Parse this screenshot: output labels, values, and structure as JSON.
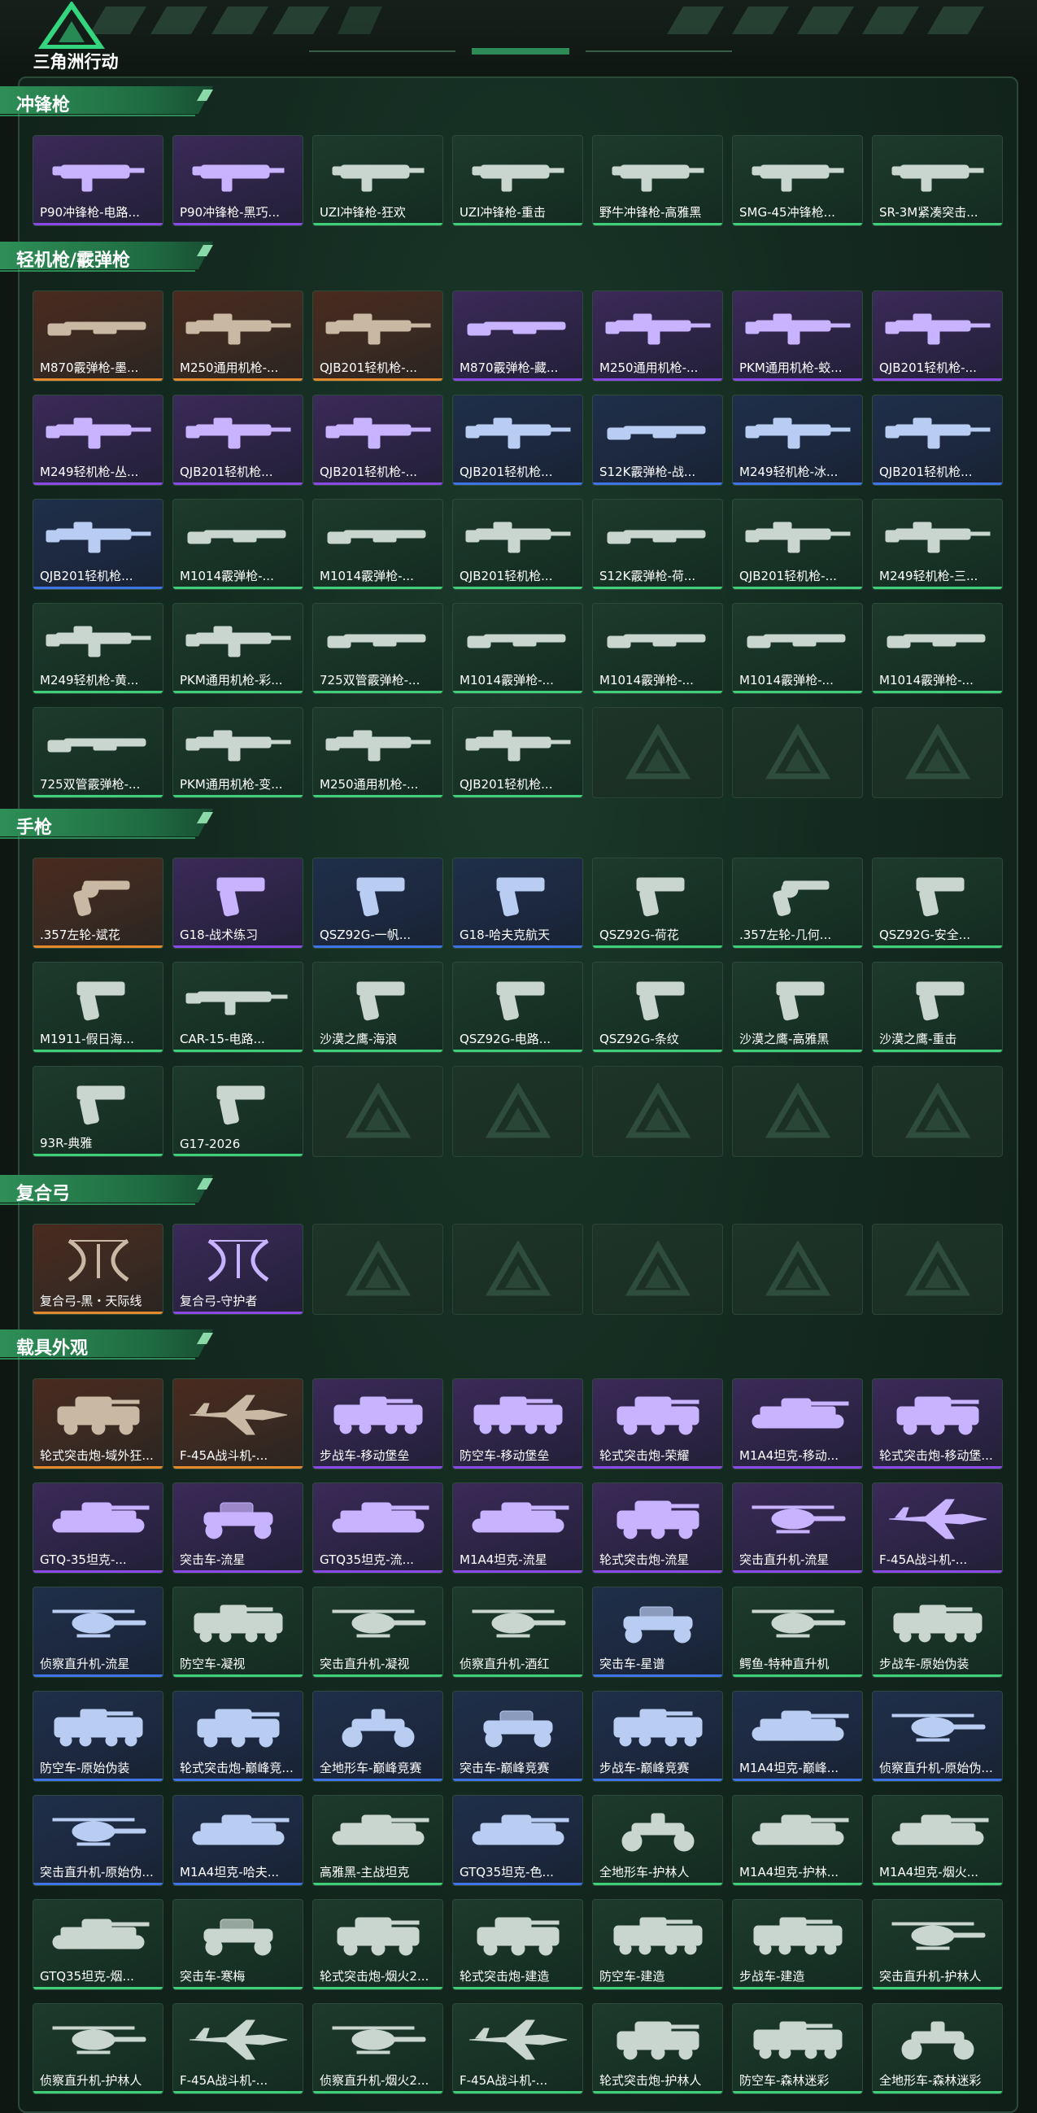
{
  "app": {
    "logo_text": "三角洲行动"
  },
  "colors": {
    "accent": "#3fcf7a",
    "rarity_gold": "#e58a2c",
    "rarity_purple": "#8a4ae6",
    "rarity_blue": "#3f74e6",
    "rarity_green": "#3fcf7a"
  },
  "sections": [
    {
      "title": "冲锋枪",
      "items": [
        {
          "label": "P90冲锋枪-电路...",
          "rarity": "purple",
          "icon": "smg-icon"
        },
        {
          "label": "P90冲锋枪-黑巧...",
          "rarity": "purple",
          "icon": "smg-icon"
        },
        {
          "label": "UZI冲锋枪-狂欢",
          "rarity": "green",
          "icon": "smg-icon"
        },
        {
          "label": "UZI冲锋枪-重击",
          "rarity": "green",
          "icon": "smg-icon"
        },
        {
          "label": "野牛冲锋枪-高雅黑",
          "rarity": "green",
          "icon": "smg-icon"
        },
        {
          "label": "SMG-45冲锋枪...",
          "rarity": "green",
          "icon": "smg-icon"
        },
        {
          "label": "SR-3M紧凑突击...",
          "rarity": "green",
          "icon": "smg-icon"
        }
      ]
    },
    {
      "title": "轻机枪/霰弹枪",
      "items": [
        {
          "label": "M870霰弹枪-墨...",
          "rarity": "gold",
          "icon": "shotgun-icon"
        },
        {
          "label": "M250通用机枪-...",
          "rarity": "gold",
          "icon": "lmg-icon"
        },
        {
          "label": "QJB201轻机枪-...",
          "rarity": "gold",
          "icon": "lmg-icon"
        },
        {
          "label": "M870霰弹枪-藏...",
          "rarity": "purple",
          "icon": "shotgun-icon"
        },
        {
          "label": "M250通用机枪-...",
          "rarity": "purple",
          "icon": "lmg-icon"
        },
        {
          "label": "PKM通用机枪-蛟...",
          "rarity": "purple",
          "icon": "lmg-icon"
        },
        {
          "label": "QJB201轻机枪-...",
          "rarity": "purple",
          "icon": "lmg-icon"
        },
        {
          "label": "M249轻机枪-丛...",
          "rarity": "purple",
          "icon": "lmg-icon"
        },
        {
          "label": "QJB201轻机枪...",
          "rarity": "purple",
          "icon": "lmg-icon"
        },
        {
          "label": "QJB201轻机枪-...",
          "rarity": "purple",
          "icon": "lmg-icon"
        },
        {
          "label": "QJB201轻机枪...",
          "rarity": "blue",
          "icon": "lmg-icon"
        },
        {
          "label": "S12K霰弹枪-战...",
          "rarity": "blue",
          "icon": "shotgun-icon"
        },
        {
          "label": "M249轻机枪-冰...",
          "rarity": "blue",
          "icon": "lmg-icon"
        },
        {
          "label": "QJB201轻机枪...",
          "rarity": "blue",
          "icon": "lmg-icon"
        },
        {
          "label": "QJB201轻机枪...",
          "rarity": "blue",
          "icon": "lmg-icon"
        },
        {
          "label": "M1014霰弹枪-...",
          "rarity": "green",
          "icon": "shotgun-icon"
        },
        {
          "label": "M1014霰弹枪-...",
          "rarity": "green",
          "icon": "shotgun-icon"
        },
        {
          "label": "QJB201轻机枪...",
          "rarity": "green",
          "icon": "lmg-icon"
        },
        {
          "label": "S12K霰弹枪-荷...",
          "rarity": "green",
          "icon": "shotgun-icon"
        },
        {
          "label": "QJB201轻机枪-...",
          "rarity": "green",
          "icon": "lmg-icon"
        },
        {
          "label": "M249轻机枪-三...",
          "rarity": "green",
          "icon": "lmg-icon"
        },
        {
          "label": "M249轻机枪-黄...",
          "rarity": "green",
          "icon": "lmg-icon"
        },
        {
          "label": "PKM通用机枪-彩...",
          "rarity": "green",
          "icon": "lmg-icon"
        },
        {
          "label": "725双管霰弹枪-...",
          "rarity": "green",
          "icon": "shotgun-icon"
        },
        {
          "label": "M1014霰弹枪-...",
          "rarity": "green",
          "icon": "shotgun-icon"
        },
        {
          "label": "M1014霰弹枪-...",
          "rarity": "green",
          "icon": "shotgun-icon"
        },
        {
          "label": "M1014霰弹枪-...",
          "rarity": "green",
          "icon": "shotgun-icon"
        },
        {
          "label": "M1014霰弹枪-...",
          "rarity": "green",
          "icon": "shotgun-icon"
        },
        {
          "label": "725双管霰弹枪-...",
          "rarity": "green",
          "icon": "shotgun-icon"
        },
        {
          "label": "PKM通用机枪-变...",
          "rarity": "green",
          "icon": "lmg-icon"
        },
        {
          "label": "M250通用机枪-...",
          "rarity": "green",
          "icon": "lmg-icon"
        },
        {
          "label": "QJB201轻机枪...",
          "rarity": "green",
          "icon": "lmg-icon"
        },
        {
          "empty": true
        },
        {
          "empty": true
        },
        {
          "empty": true
        }
      ]
    },
    {
      "title": "手枪",
      "items": [
        {
          "label": ".357左轮-斌花",
          "rarity": "gold",
          "icon": "revolver-icon"
        },
        {
          "label": "G18-战术练习",
          "rarity": "purple",
          "icon": "pistol-icon"
        },
        {
          "label": "QSZ92G-一帆...",
          "rarity": "blue",
          "icon": "pistol-icon"
        },
        {
          "label": "G18-哈夫克航天",
          "rarity": "blue",
          "icon": "pistol-icon"
        },
        {
          "label": "QSZ92G-荷花",
          "rarity": "green",
          "icon": "pistol-icon"
        },
        {
          "label": ".357左轮-几何...",
          "rarity": "green",
          "icon": "revolver-icon"
        },
        {
          "label": "QSZ92G-安全...",
          "rarity": "green",
          "icon": "pistol-icon"
        },
        {
          "label": "M1911-假日海...",
          "rarity": "green",
          "icon": "pistol-icon"
        },
        {
          "label": "CAR-15-电路...",
          "rarity": "green",
          "icon": "rifle-icon"
        },
        {
          "label": "沙漠之鹰-海浪",
          "rarity": "green",
          "icon": "pistol-icon"
        },
        {
          "label": "QSZ92G-电路...",
          "rarity": "green",
          "icon": "pistol-icon"
        },
        {
          "label": "QSZ92G-条纹",
          "rarity": "green",
          "icon": "pistol-icon"
        },
        {
          "label": "沙漠之鹰-高雅黑",
          "rarity": "green",
          "icon": "pistol-icon"
        },
        {
          "label": "沙漠之鹰-重击",
          "rarity": "green",
          "icon": "pistol-icon"
        },
        {
          "label": "93R-典雅",
          "rarity": "green",
          "icon": "pistol-icon"
        },
        {
          "label": "G17-2026",
          "rarity": "green",
          "icon": "pistol-icon"
        },
        {
          "empty": true
        },
        {
          "empty": true
        },
        {
          "empty": true
        },
        {
          "empty": true
        },
        {
          "empty": true
        }
      ]
    },
    {
      "title": "复合弓",
      "items": [
        {
          "label": "复合弓-黑・天际线",
          "rarity": "gold",
          "icon": "bow-icon"
        },
        {
          "label": "复合弓-守护者",
          "rarity": "purple",
          "icon": "bow-icon"
        },
        {
          "empty": true
        },
        {
          "empty": true
        },
        {
          "empty": true
        },
        {
          "empty": true
        },
        {
          "empty": true
        }
      ]
    },
    {
      "title": "载具外观",
      "items": [
        {
          "label": "轮式突击炮-域外狂...",
          "rarity": "gold",
          "icon": "armored-car-icon"
        },
        {
          "label": "F-45A战斗机-...",
          "rarity": "gold",
          "icon": "jet-icon"
        },
        {
          "label": "步战车-移动堡垒",
          "rarity": "purple",
          "icon": "apc-icon"
        },
        {
          "label": "防空车-移动堡垒",
          "rarity": "purple",
          "icon": "apc-icon"
        },
        {
          "label": "轮式突击炮-荣耀",
          "rarity": "purple",
          "icon": "armored-car-icon"
        },
        {
          "label": "M1A4坦克-移动...",
          "rarity": "purple",
          "icon": "tank-icon"
        },
        {
          "label": "轮式突击炮-移动堡...",
          "rarity": "purple",
          "icon": "armored-car-icon"
        },
        {
          "label": "GTQ-35坦克-...",
          "rarity": "purple",
          "icon": "tank-icon"
        },
        {
          "label": "突击车-流星",
          "rarity": "purple",
          "icon": "buggy-icon"
        },
        {
          "label": "GTQ35坦克-流...",
          "rarity": "purple",
          "icon": "tank-icon"
        },
        {
          "label": "M1A4坦克-流星",
          "rarity": "purple",
          "icon": "tank-icon"
        },
        {
          "label": "轮式突击炮-流星",
          "rarity": "purple",
          "icon": "armored-car-icon"
        },
        {
          "label": "突击直升机-流星",
          "rarity": "purple",
          "icon": "helicopter-icon"
        },
        {
          "label": "F-45A战斗机-...",
          "rarity": "purple",
          "icon": "jet-icon"
        },
        {
          "label": "侦察直升机-流星",
          "rarity": "blue",
          "icon": "helicopter-icon"
        },
        {
          "label": "防空车-凝视",
          "rarity": "green",
          "icon": "apc-icon"
        },
        {
          "label": "突击直升机-凝视",
          "rarity": "green",
          "icon": "helicopter-icon"
        },
        {
          "label": "侦察直升机-酒红",
          "rarity": "green",
          "icon": "helicopter-icon"
        },
        {
          "label": "突击车-星谱",
          "rarity": "blue",
          "icon": "buggy-icon"
        },
        {
          "label": "鳄鱼-特种直升机",
          "rarity": "green",
          "icon": "helicopter-icon"
        },
        {
          "label": "步战车-原始伪装",
          "rarity": "green",
          "icon": "apc-icon"
        },
        {
          "label": "防空车-原始伪装",
          "rarity": "blue",
          "icon": "apc-icon"
        },
        {
          "label": "轮式突击炮-巅峰竞...",
          "rarity": "blue",
          "icon": "armored-car-icon"
        },
        {
          "label": "全地形车-巅峰竞赛",
          "rarity": "blue",
          "icon": "atv-icon"
        },
        {
          "label": "突击车-巅峰竞赛",
          "rarity": "blue",
          "icon": "buggy-icon"
        },
        {
          "label": "步战车-巅峰竞赛",
          "rarity": "blue",
          "icon": "apc-icon"
        },
        {
          "label": "M1A4坦克-巅峰...",
          "rarity": "blue",
          "icon": "tank-icon"
        },
        {
          "label": "侦察直升机-原始伪...",
          "rarity": "blue",
          "icon": "helicopter-icon"
        },
        {
          "label": "突击直升机-原始伪...",
          "rarity": "blue",
          "icon": "helicopter-icon"
        },
        {
          "label": "M1A4坦克-哈夫...",
          "rarity": "blue",
          "icon": "tank-icon"
        },
        {
          "label": "高雅黑-主战坦克",
          "rarity": "green",
          "icon": "tank-icon"
        },
        {
          "label": "GTQ35坦克-色...",
          "rarity": "blue",
          "icon": "tank-icon"
        },
        {
          "label": "全地形车-护林人",
          "rarity": "green",
          "icon": "atv-icon"
        },
        {
          "label": "M1A4坦克-护林...",
          "rarity": "green",
          "icon": "tank-icon"
        },
        {
          "label": "M1A4坦克-烟火...",
          "rarity": "green",
          "icon": "tank-icon"
        },
        {
          "label": "GTQ35坦克-烟...",
          "rarity": "green",
          "icon": "tank-icon"
        },
        {
          "label": "突击车-寒梅",
          "rarity": "green",
          "icon": "buggy-icon"
        },
        {
          "label": "轮式突击炮-烟火2...",
          "rarity": "green",
          "icon": "armored-car-icon"
        },
        {
          "label": "轮式突击炮-建造",
          "rarity": "green",
          "icon": "armored-car-icon"
        },
        {
          "label": "防空车-建造",
          "rarity": "green",
          "icon": "apc-icon"
        },
        {
          "label": "步战车-建造",
          "rarity": "green",
          "icon": "apc-icon"
        },
        {
          "label": "突击直升机-护林人",
          "rarity": "green",
          "icon": "helicopter-icon"
        },
        {
          "label": "侦察直升机-护林人",
          "rarity": "green",
          "icon": "helicopter-icon"
        },
        {
          "label": "F-45A战斗机-...",
          "rarity": "green",
          "icon": "jet-icon"
        },
        {
          "label": "侦察直升机-烟火2...",
          "rarity": "green",
          "icon": "helicopter-icon"
        },
        {
          "label": "F-45A战斗机-...",
          "rarity": "green",
          "icon": "jet-icon"
        },
        {
          "label": "轮式突击炮-护林人",
          "rarity": "green",
          "icon": "armored-car-icon"
        },
        {
          "label": "防空车-森林迷彩",
          "rarity": "green",
          "icon": "apc-icon"
        },
        {
          "label": "全地形车-森林迷彩",
          "rarity": "green",
          "icon": "atv-icon"
        }
      ]
    }
  ]
}
